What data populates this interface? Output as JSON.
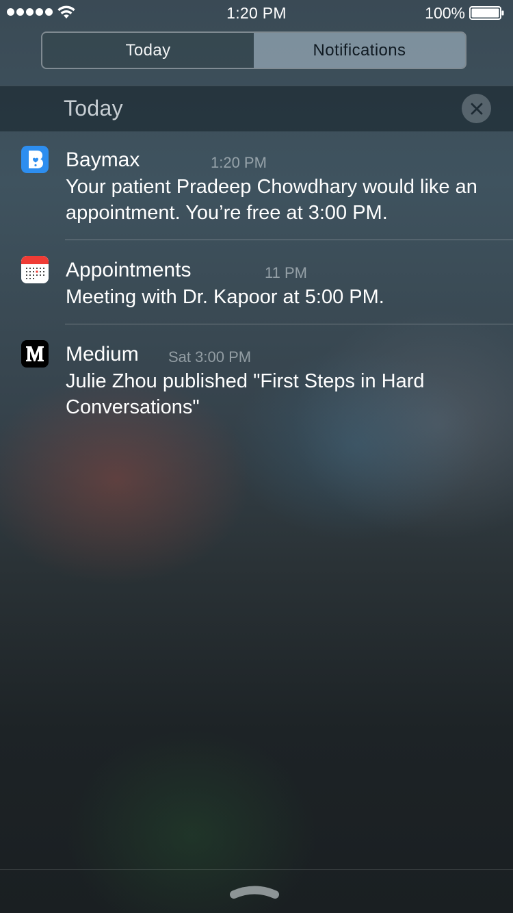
{
  "status_bar": {
    "time": "1:20 PM",
    "battery_percent": "100%",
    "signal_bars": 5,
    "battery_level": 1.0
  },
  "tabs": [
    {
      "label": "Today",
      "selected": false
    },
    {
      "label": "Notifications",
      "selected": true
    }
  ],
  "section": {
    "title": "Today"
  },
  "notifications": [
    {
      "app": "Baymax",
      "time": "1:20 PM",
      "message": "Your patient Pradeep Chowdhary would like an appointment. You’re free at 3:00 PM.",
      "icon": "baymax-app-icon"
    },
    {
      "app": "Appointments",
      "time": "11 PM",
      "message": "Meeting with Dr. Kapoor at 5:00 PM.",
      "icon": "calendar-app-icon"
    },
    {
      "app": "Medium",
      "time": "Sat 3:00 PM",
      "message": "Julie Zhou published \"First Steps in Hard Conversations\"",
      "icon": "medium-app-icon"
    }
  ],
  "icons": {
    "wifi": "wifi-icon",
    "battery": "battery-icon",
    "clear": "close-icon",
    "grabber": "grabber-chevron-icon"
  },
  "colors": {
    "baymax_blue": "#2d8ef0",
    "calendar_red": "#f03c35",
    "medium_black": "#000000"
  }
}
